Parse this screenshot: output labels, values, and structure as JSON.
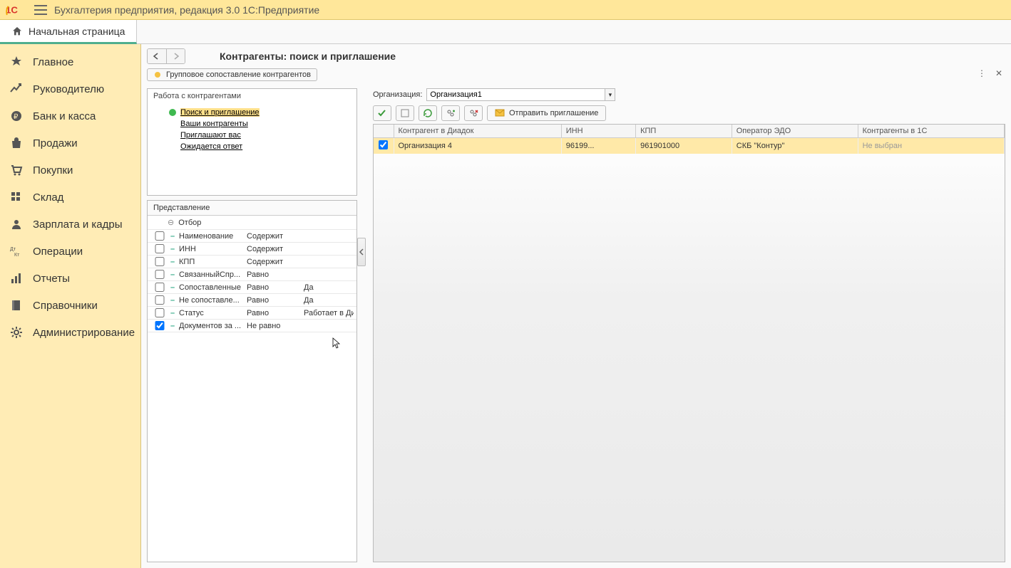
{
  "header": {
    "app_title": "Бухгалтерия предприятия, редакция 3.0 1С:Предприятие"
  },
  "tab": {
    "home_label": "Начальная страница"
  },
  "sidebar": {
    "items": [
      {
        "label": "Главное",
        "icon": "star"
      },
      {
        "label": "Руководителю",
        "icon": "trend"
      },
      {
        "label": "Банк и касса",
        "icon": "ruble"
      },
      {
        "label": "Продажи",
        "icon": "bag"
      },
      {
        "label": "Покупки",
        "icon": "cart"
      },
      {
        "label": "Склад",
        "icon": "grid"
      },
      {
        "label": "Зарплата и кадры",
        "icon": "person"
      },
      {
        "label": "Операции",
        "icon": "dtkt"
      },
      {
        "label": "Отчеты",
        "icon": "bars"
      },
      {
        "label": "Справочники",
        "icon": "book"
      },
      {
        "label": "Администрирование",
        "icon": "gear"
      }
    ]
  },
  "page": {
    "title": "Контрагенты: поиск и приглашение",
    "group_btn": "Групповое сопоставление контрагентов"
  },
  "leftbox": {
    "title": "Работа с контрагентами",
    "items": [
      "Поиск и приглашение",
      "Ваши контрагенты",
      "Приглашают вас",
      "Ожидается ответ"
    ]
  },
  "filters": {
    "header": "Представление",
    "group": "Отбор",
    "rows": [
      {
        "checked": false,
        "name": "Наименование",
        "cond": "Содержит",
        "val": ""
      },
      {
        "checked": false,
        "name": "ИНН",
        "cond": "Содержит",
        "val": ""
      },
      {
        "checked": false,
        "name": "КПП",
        "cond": "Содержит",
        "val": ""
      },
      {
        "checked": false,
        "name": "СвязанныйСпр...",
        "cond": "Равно",
        "val": ""
      },
      {
        "checked": false,
        "name": "Сопоставленные",
        "cond": "Равно",
        "val": "Да"
      },
      {
        "checked": false,
        "name": "Не сопоставле...",
        "cond": "Равно",
        "val": "Да"
      },
      {
        "checked": false,
        "name": "Статус",
        "cond": "Равно",
        "val": "Работает в Диадок"
      },
      {
        "checked": true,
        "name": "Документов за ...",
        "cond": "Не равно",
        "val": ""
      }
    ]
  },
  "right": {
    "org_label": "Организация:",
    "org_value": "Организация1",
    "send_btn": "Отправить приглашение",
    "columns": [
      "",
      "Контрагент в Диадок",
      "ИНН",
      "КПП",
      "Оператор ЭДО",
      "Контрагенты в 1С"
    ],
    "rows": [
      {
        "checked": true,
        "name": "Организация 4",
        "inn": "96199...",
        "kpp": "961901000",
        "op": "СКБ \"Контур\"",
        "c1s": "Не выбран"
      }
    ]
  }
}
